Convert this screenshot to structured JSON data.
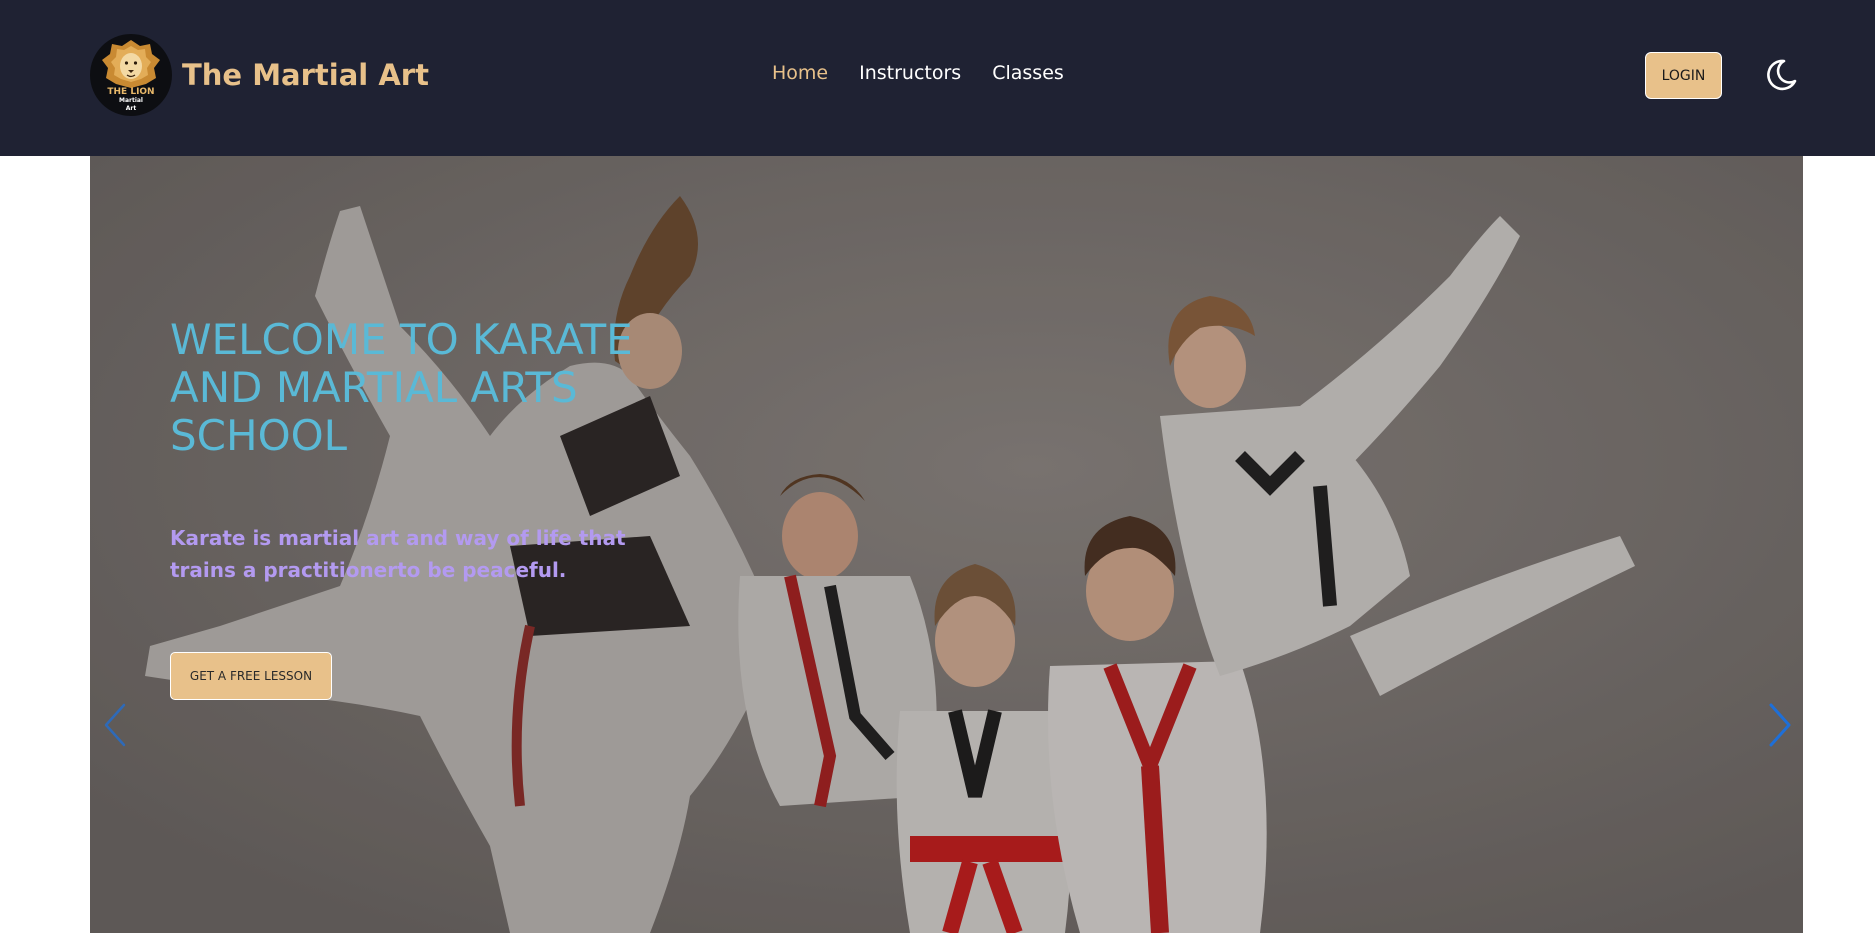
{
  "brand": {
    "name": "The Martial Art",
    "logo_line1": "THE LION",
    "logo_line2": "Martial",
    "logo_line3": "Art",
    "logo_icon": "lion-head-icon"
  },
  "nav": {
    "items": [
      {
        "label": "Home",
        "active": true
      },
      {
        "label": "Instructors",
        "active": false
      },
      {
        "label": "Classes",
        "active": false
      }
    ],
    "login_label": "LOGIN",
    "theme_icon": "moon-icon"
  },
  "hero": {
    "title": "WELCOME TO KARATE AND MARTIAL ARTS SCHOOL",
    "subtitle": "Karate is martial art and way of life that trains a practitionerto be peaceful.",
    "cta_label": "GET A FREE LESSON",
    "prev_icon": "chevron-left-icon",
    "next_icon": "chevron-right-icon"
  },
  "colors": {
    "navbar_bg": "#1f2233",
    "accent_gold": "#e8c18a",
    "title_color": "#5ab9d6",
    "subtitle_color": "#b39af0",
    "arrow_color": "#1e6fd8"
  }
}
